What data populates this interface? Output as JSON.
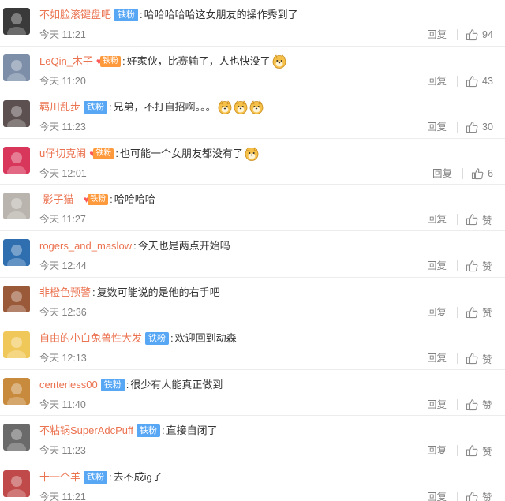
{
  "ui": {
    "reply_label": "回复",
    "like_word": "赞",
    "fan_badge": "铁粉",
    "colon": ":"
  },
  "comments": [
    {
      "user": "不如脸滚键盘吧",
      "badge": "blue",
      "text": "哈哈哈哈哈这女朋友的操作秀到了",
      "time": "今天 11:21",
      "likes": "94",
      "emojis": 0,
      "avatar": "#3a3a3a",
      "avatar_hint": "dark-face"
    },
    {
      "user": "LeQin_木子",
      "badge": "orange",
      "text": "好家伙，比赛输了，人也快没了",
      "time": "今天 11:20",
      "likes": "43",
      "emojis": 1,
      "avatar": "#7d8fa8",
      "avatar_hint": "grey-figure"
    },
    {
      "user": "羁川乱步",
      "badge": "blue",
      "text": "兄弟，不打自招啊。。。",
      "time": "今天 11:23",
      "likes": "30",
      "emojis": 3,
      "avatar": "#5c5050",
      "avatar_hint": "character"
    },
    {
      "user": "u仔切克闹",
      "badge": "orange",
      "text": "也可能一个女朋友都没有了",
      "time": "今天 12:01",
      "likes": "6",
      "emojis": 1,
      "avatar": "#d8365a",
      "avatar_hint": "letter-u"
    },
    {
      "user": "-影子猫--",
      "badge": "orange",
      "text": "哈哈哈哈",
      "time": "今天 11:27",
      "likes": "赞",
      "emojis": 0,
      "avatar": "#b9b4ad",
      "avatar_hint": "cat"
    },
    {
      "user": "rogers_and_maslow",
      "badge": "none",
      "text": "今天也是两点开始吗",
      "time": "今天 12:44",
      "likes": "赞",
      "emojis": 0,
      "avatar": "#2f6fb0",
      "avatar_hint": "anime-blue"
    },
    {
      "user": "非橙色预警",
      "badge": "none",
      "text": "复数可能说的是他的右手吧",
      "time": "今天 12:36",
      "likes": "赞",
      "emojis": 0,
      "avatar": "#9a5a3a",
      "avatar_hint": "monkey"
    },
    {
      "user": "自由的小白兔兽性大发",
      "badge": "blue",
      "text": "欢迎回到动森",
      "time": "今天 12:13",
      "likes": "赞",
      "emojis": 0,
      "avatar": "#f0c85a",
      "avatar_hint": "cartoon-yellow"
    },
    {
      "user": "centerless00",
      "badge": "blue",
      "text": "很少有人能真正做到",
      "time": "今天 11:40",
      "likes": "赞",
      "emojis": 0,
      "avatar": "#c88a3c",
      "avatar_hint": "doge"
    },
    {
      "user": "不粘锅SuperAdcPuff",
      "badge": "blue",
      "text": "直接自闭了",
      "time": "今天 11:23",
      "likes": "赞",
      "emojis": 0,
      "avatar": "#6a6a6a",
      "avatar_hint": "photo"
    },
    {
      "user": "十一个羊",
      "badge": "blue",
      "text": "去不成ig了",
      "time": "今天 11:21",
      "likes": "赞",
      "emojis": 0,
      "avatar": "#c04a4a",
      "avatar_hint": "red-photo"
    }
  ],
  "colors": {
    "username": "#eb7350",
    "blue_badge": "#57a7f5",
    "orange_badge": "#ff9a3c",
    "meta_text": "#808080",
    "divider": "#ececec"
  }
}
